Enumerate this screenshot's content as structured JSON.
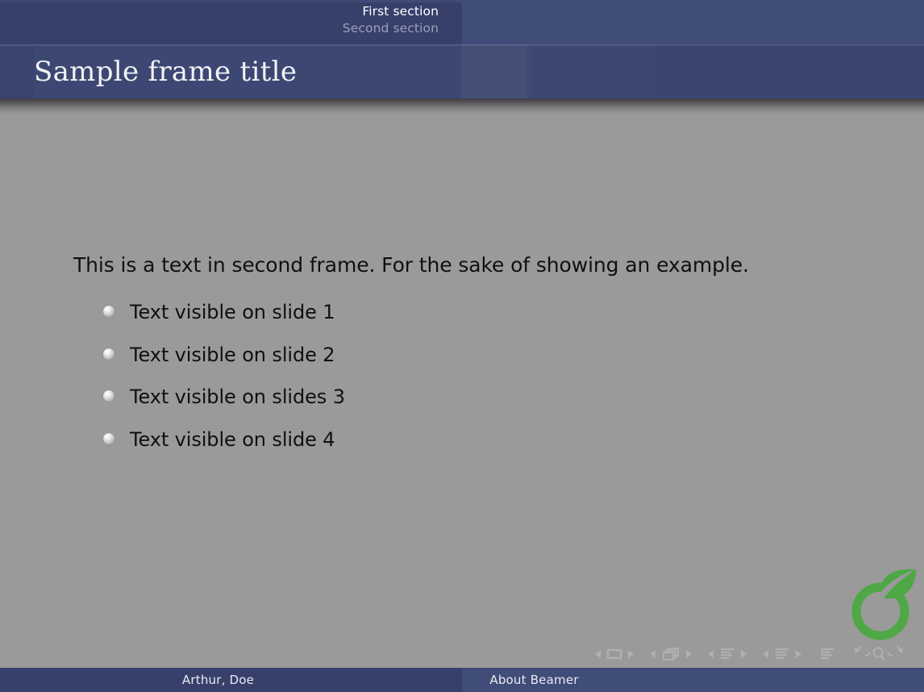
{
  "theme": {
    "nav_bar_dark": "#36406b",
    "nav_bar_light": "#404d78",
    "title_bar": "#3a4671",
    "body_background": "#9a9a9a",
    "body_text": "#101010",
    "title_text": "#f2f2f5",
    "active_section_text": "#ffffff",
    "inactive_section_text": "#9aa0b8",
    "logo_green": "#4fa846",
    "nav_symbol_color": "#b0b0b0"
  },
  "headline": {
    "sections": [
      {
        "label": "First section",
        "state": "active"
      },
      {
        "label": "Second section",
        "state": "inactive"
      }
    ]
  },
  "title_bar": {
    "frame_title": "Sample frame title"
  },
  "content": {
    "intro": "This is a text in second frame.  For the sake of showing an example.",
    "bullets": [
      {
        "text": "Text visible on slide 1"
      },
      {
        "text": "Text visible on slide 2"
      },
      {
        "text": "Text visible on slides 3"
      },
      {
        "text": "Text visible on slide 4"
      }
    ]
  },
  "logo": {
    "name": "overleaf-logo"
  },
  "navigation_symbols": {
    "groups": [
      {
        "name": "slide-navigation",
        "icons": [
          "prev-slide-icon",
          "slide-icon",
          "next-slide-icon"
        ]
      },
      {
        "name": "frame-navigation",
        "icons": [
          "prev-frame-icon",
          "frame-icon",
          "next-frame-icon"
        ]
      },
      {
        "name": "subsection-navigation",
        "icons": [
          "prev-subsection-icon",
          "subsection-icon",
          "next-subsection-icon"
        ]
      },
      {
        "name": "section-navigation",
        "icons": [
          "prev-section-icon",
          "section-icon",
          "next-section-icon"
        ]
      },
      {
        "name": "document-navigation",
        "icons": [
          "document-icon"
        ]
      },
      {
        "name": "utility-navigation",
        "icons": [
          "back-icon",
          "search-icon",
          "forward-icon"
        ]
      }
    ]
  },
  "footline": {
    "author": "Arthur, Doe",
    "title": "About Beamer"
  }
}
